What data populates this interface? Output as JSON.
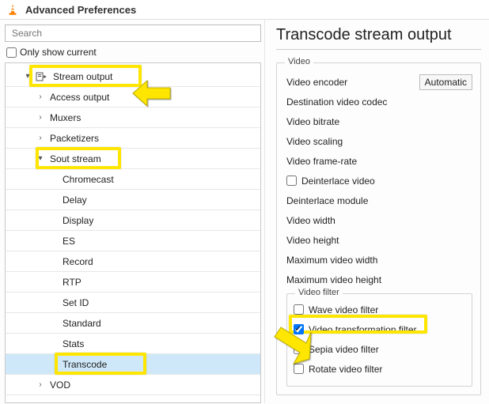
{
  "window": {
    "title": "Advanced Preferences"
  },
  "search": {
    "placeholder": "Search"
  },
  "only_current": {
    "label": "Only show current"
  },
  "tree": {
    "stream_output": "Stream output",
    "access_output": "Access output",
    "muxers": "Muxers",
    "packetizers": "Packetizers",
    "sout_stream": "Sout stream",
    "chromecast": "Chromecast",
    "delay": "Delay",
    "display": "Display",
    "es": "ES",
    "record": "Record",
    "rtp": "RTP",
    "set_id": "Set ID",
    "standard": "Standard",
    "stats": "Stats",
    "transcode": "Transcode",
    "vod": "VOD"
  },
  "page": {
    "title": "Transcode stream output"
  },
  "video_group": {
    "legend": "Video",
    "encoder_label": "Video encoder",
    "encoder_value": "Automatic",
    "dest_codec": "Destination video codec",
    "bitrate": "Video bitrate",
    "scaling": "Video scaling",
    "framerate": "Video frame-rate",
    "deinterlace": "Deinterlace video",
    "deint_module": "Deinterlace module",
    "width": "Video width",
    "height": "Video height",
    "max_width": "Maximum video width",
    "max_height": "Maximum video height",
    "filter_legend": "Video filter",
    "filters": {
      "wave": "Wave video filter",
      "transform": "Video transformation filter",
      "sepia": "Sepia video filter",
      "rotate": "Rotate video filter"
    }
  }
}
